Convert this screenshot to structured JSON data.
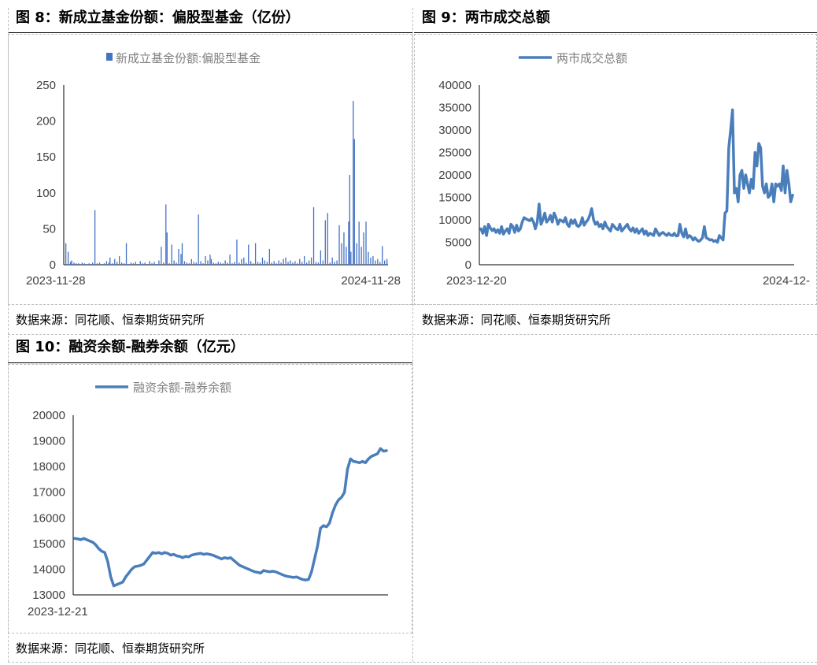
{
  "panels": [
    {
      "title": "图 8：新成立基金份额：偏股型基金（亿份）",
      "source": "数据来源：同花顺、恒泰期货研究所"
    },
    {
      "title": "图 9：两市成交总额",
      "source": "数据来源：同花顺、恒泰期货研究所"
    },
    {
      "title": "图 10：融资余额-融券余额（亿元）",
      "source": "数据来源：同花顺、恒泰期货研究所"
    }
  ],
  "chart_data": [
    {
      "type": "bar",
      "legend": "新成立基金份额:偏股型基金",
      "legend_position": "top",
      "x_ticks": [
        "2023-11-28",
        "2024-11-28"
      ],
      "y_ticks": [
        0,
        50,
        100,
        150,
        200,
        250
      ],
      "ylim": [
        0,
        250
      ],
      "grid": false,
      "color": "#4472C4",
      "values": [
        30,
        0,
        18,
        0,
        4,
        6,
        0,
        3,
        0,
        2,
        0,
        2,
        1,
        0,
        3,
        0,
        2,
        0,
        1,
        0,
        2,
        0,
        0,
        3,
        0,
        76,
        0,
        2,
        0,
        3,
        0,
        1,
        0,
        2,
        0,
        5,
        0,
        3,
        10,
        0,
        2,
        0,
        8,
        0,
        4,
        0,
        12,
        0,
        3,
        0,
        2,
        0,
        30,
        0,
        1,
        0,
        3,
        0,
        2,
        0,
        4,
        0,
        1,
        0,
        5,
        0,
        2,
        0,
        3,
        0,
        1,
        0,
        5,
        0,
        2,
        0,
        4,
        0,
        1,
        0,
        6,
        0,
        25,
        0,
        3,
        0,
        84,
        45,
        0,
        2,
        0,
        28,
        0,
        6,
        0,
        3,
        0,
        22,
        0,
        15,
        30,
        0,
        5,
        0,
        3,
        0,
        2,
        0,
        8,
        0,
        4,
        0,
        3,
        0,
        70,
        0,
        5,
        0,
        2,
        0,
        12,
        0,
        6,
        0,
        14,
        8,
        0,
        3,
        0,
        2,
        0,
        4,
        0,
        3,
        0,
        2,
        0,
        6,
        0,
        3,
        0,
        14,
        0,
        2,
        0,
        4,
        0,
        35,
        0,
        3,
        0,
        8,
        0,
        10,
        0,
        3,
        0,
        28,
        0,
        5,
        0,
        2,
        0,
        30,
        0,
        4,
        0,
        3,
        0,
        10,
        0,
        6,
        0,
        4,
        0,
        22,
        0,
        3,
        0,
        5,
        0,
        2,
        0,
        6,
        0,
        3,
        0,
        8,
        0,
        10,
        0,
        4,
        0,
        6,
        0,
        3,
        0,
        5,
        0,
        2,
        0,
        8,
        0,
        4,
        0,
        12,
        0,
        3,
        0,
        6,
        0,
        10,
        0,
        80,
        0,
        4,
        0,
        3,
        0,
        20,
        0,
        6,
        0,
        62,
        0,
        72,
        0,
        3,
        0,
        10,
        0,
        4,
        0,
        6,
        0,
        55,
        0,
        30,
        0,
        45,
        0,
        25,
        0,
        60,
        125,
        18,
        0,
        228,
        175,
        0,
        30,
        0,
        60,
        0,
        25,
        0,
        45,
        0,
        60,
        0,
        18,
        0,
        10,
        0,
        12,
        0,
        6,
        0,
        8,
        0,
        4,
        0,
        26,
        0,
        6,
        0,
        8
      ]
    },
    {
      "type": "line",
      "legend": "两市成交总额",
      "legend_position": "top",
      "x_ticks": [
        "2023-12-20",
        "2024-12-"
      ],
      "y_ticks": [
        0,
        5000,
        10000,
        15000,
        20000,
        25000,
        30000,
        35000,
        40000
      ],
      "ylim": [
        0,
        40000
      ],
      "grid": false,
      "color": "#4A7EBB",
      "values": [
        8000,
        7000,
        8500,
        6500,
        9000,
        8200,
        7600,
        8000,
        7200,
        7800,
        7000,
        8500,
        6800,
        7500,
        8000,
        7000,
        9000,
        8500,
        7200,
        8800,
        7500,
        8000,
        9500,
        10500,
        10200,
        10000,
        9800,
        10300,
        9500,
        8000,
        9500,
        13500,
        9000,
        10000,
        11500,
        9500,
        10000,
        11000,
        9500,
        11500,
        10500,
        9000,
        10000,
        9800,
        9500,
        10500,
        9000,
        8500,
        10000,
        9200,
        10000,
        8800,
        8500,
        9000,
        10500,
        8800,
        9500,
        10000,
        11000,
        12500,
        10000,
        9000,
        9500,
        8500,
        9000,
        8000,
        9500,
        8500,
        8000,
        7500,
        9000,
        8500,
        8000,
        7800,
        9000,
        7500,
        8000,
        8500,
        9000,
        8000,
        7500,
        8200,
        7200,
        8000,
        7000,
        7500,
        8000,
        6800,
        7500,
        6500,
        7000,
        6800,
        6500,
        8000,
        7200,
        6500,
        7000,
        7200,
        6800,
        6500,
        7000,
        6600,
        6500,
        7000,
        6400,
        6500,
        9000,
        7000,
        6200,
        8000,
        6000,
        6500,
        6200,
        5500,
        6000,
        5500,
        5200,
        5500,
        6000,
        8500,
        6000,
        5800,
        5500,
        5600,
        5200,
        5400,
        5000,
        6500,
        6000,
        5500,
        11500,
        12000,
        26000,
        30000,
        34500,
        16000,
        17000,
        14000,
        20000,
        21000,
        17000,
        20000,
        18000,
        16000,
        19000,
        17000,
        25000,
        22000,
        27000,
        26000,
        17500,
        16000,
        18000,
        15000,
        15500,
        18000,
        14000,
        18000,
        17500,
        18000,
        16500,
        22000,
        16000,
        21000,
        18000,
        14000,
        15500
      ]
    },
    {
      "type": "line",
      "legend": "融资余额-融券余额",
      "legend_position": "top",
      "x_ticks": [
        "2023-12-21"
      ],
      "y_ticks": [
        13000,
        14000,
        15000,
        16000,
        17000,
        18000,
        19000,
        20000
      ],
      "ylim": [
        13000,
        20000
      ],
      "grid": false,
      "color": "#4A7EBB",
      "values": [
        15200,
        15180,
        15150,
        15200,
        15150,
        15100,
        15050,
        14950,
        14800,
        14700,
        14650,
        14300,
        13700,
        13350,
        13400,
        13450,
        13500,
        13700,
        13850,
        14000,
        14100,
        14120,
        14150,
        14200,
        14350,
        14500,
        14650,
        14620,
        14650,
        14600,
        14650,
        14620,
        14550,
        14580,
        14520,
        14500,
        14450,
        14500,
        14480,
        14550,
        14580,
        14600,
        14620,
        14580,
        14600,
        14580,
        14550,
        14500,
        14450,
        14400,
        14450,
        14420,
        14450,
        14350,
        14250,
        14150,
        14100,
        14050,
        14000,
        13950,
        13900,
        13880,
        13850,
        13950,
        13920,
        13900,
        13920,
        13900,
        13850,
        13800,
        13750,
        13720,
        13700,
        13680,
        13700,
        13650,
        13600,
        13580,
        13600,
        13900,
        14400,
        14900,
        15600,
        15700,
        15650,
        15800,
        16200,
        16500,
        16700,
        16800,
        17000,
        17900,
        18300,
        18200,
        18180,
        18150,
        18200,
        18150,
        18300,
        18400,
        18450,
        18500,
        18700,
        18600,
        18620
      ]
    }
  ]
}
